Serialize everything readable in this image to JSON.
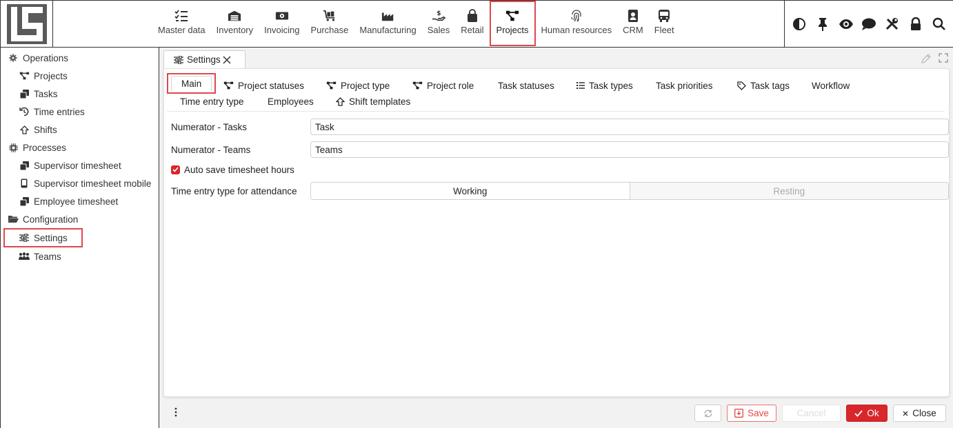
{
  "modules": [
    {
      "label": "Master data",
      "icon": "checklist-icon"
    },
    {
      "label": "Inventory",
      "icon": "warehouse-icon"
    },
    {
      "label": "Invoicing",
      "icon": "banknote-icon"
    },
    {
      "label": "Purchase",
      "icon": "cart-icon"
    },
    {
      "label": "Manufacturing",
      "icon": "factory-icon"
    },
    {
      "label": "Sales",
      "icon": "hand-dollar-icon"
    },
    {
      "label": "Retail",
      "icon": "bag-icon"
    },
    {
      "label": "Projects",
      "icon": "project-diagram-icon",
      "active": true
    },
    {
      "label": "Human resources",
      "icon": "fingerprint-icon"
    },
    {
      "label": "CRM",
      "icon": "contact-card-icon"
    },
    {
      "label": "Fleet",
      "icon": "bus-icon"
    }
  ],
  "top_tools": [
    "contrast-icon",
    "pin-icon",
    "eye-icon",
    "chat-icon",
    "tools-icon",
    "lock-icon",
    "search-icon"
  ],
  "sidebar": {
    "operations": {
      "label": "Operations",
      "items": [
        {
          "label": "Projects"
        },
        {
          "label": "Tasks"
        },
        {
          "label": "Time entries"
        },
        {
          "label": "Shifts"
        }
      ]
    },
    "processes": {
      "label": "Processes",
      "items": [
        {
          "label": "Supervisor timesheet"
        },
        {
          "label": "Supervisor timesheet mobile"
        },
        {
          "label": "Employee timesheet"
        }
      ]
    },
    "configuration": {
      "label": "Configuration",
      "items": [
        {
          "label": "Settings",
          "active": true
        },
        {
          "label": "Teams"
        }
      ]
    }
  },
  "document_tab": {
    "label": "Settings"
  },
  "subtabs": [
    {
      "label": "Main",
      "active": true
    },
    {
      "label": "Project statuses"
    },
    {
      "label": "Project type"
    },
    {
      "label": "Project role"
    },
    {
      "label": "Task statuses"
    },
    {
      "label": "Task types"
    },
    {
      "label": "Task priorities"
    },
    {
      "label": "Task tags"
    },
    {
      "label": "Workflow"
    },
    {
      "label": "Time entry type"
    },
    {
      "label": "Employees"
    },
    {
      "label": "Shift templates"
    }
  ],
  "form": {
    "numerator_tasks": {
      "label": "Numerator - Tasks",
      "value": "Task"
    },
    "numerator_teams": {
      "label": "Numerator - Teams",
      "value": "Teams"
    },
    "auto_save": {
      "label": "Auto save timesheet hours",
      "checked": true
    },
    "attendance": {
      "label": "Time entry type for attendance",
      "options": [
        "Working",
        "Resting"
      ],
      "selected": "Working"
    }
  },
  "buttons": {
    "save": "Save",
    "cancel": "Cancel",
    "ok": "Ok",
    "close": "Close"
  },
  "colors": {
    "accent": "#d8262c",
    "highlight": "#e0464e"
  }
}
